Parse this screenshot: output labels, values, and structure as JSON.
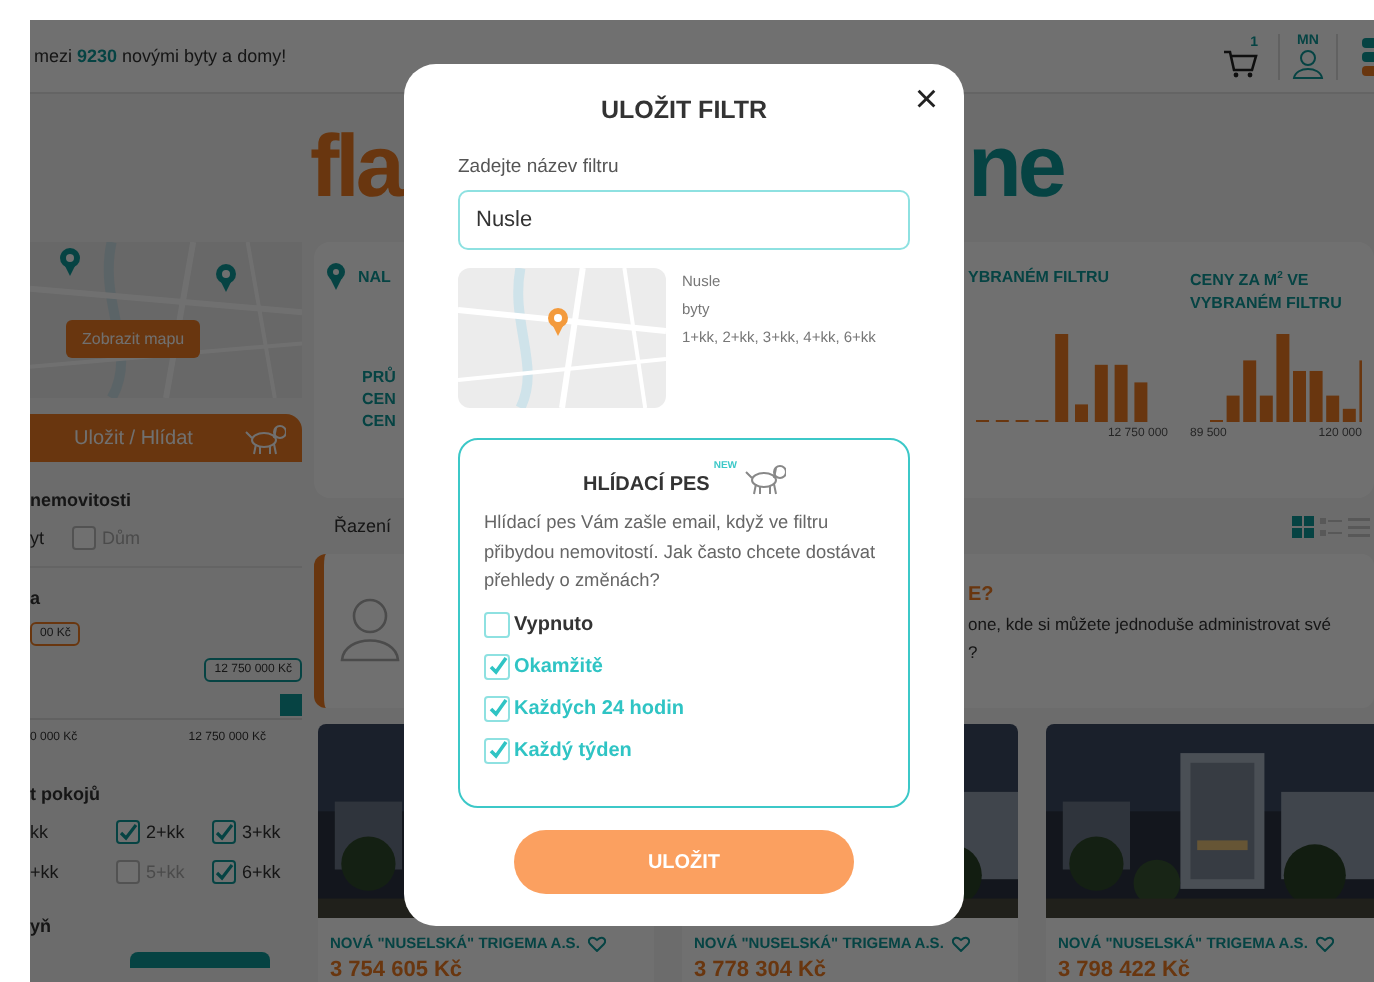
{
  "header": {
    "promo": "mezi **9230** novými byty a domy!",
    "cart_count": "1",
    "user_initials": "MN"
  },
  "logo": [
    "fla",
    "ne"
  ],
  "sidebar": {
    "map_button": "Zobrazit mapu",
    "save_bar": "Uložit / Hlídat",
    "property_heading": "nemovitosti",
    "property_options": [
      {
        "kind": "cut",
        "label": "yt"
      },
      {
        "kind": "checkbox",
        "label": "Dům",
        "checked": false,
        "disabled": true
      }
    ],
    "price": {
      "heading": "a",
      "min_field": "00 Kč",
      "max_tooltip": "12 750 000 Kč",
      "level": 1,
      "range_min": "0 000 Kč",
      "range_max": "12 750 000 Kč"
    },
    "rooms_heading": "t pokojů",
    "rooms": [
      {
        "kind": "cut",
        "label": "kk"
      },
      {
        "kind": "checkbox",
        "label": "2+kk",
        "checked": true,
        "disabled": false
      },
      {
        "kind": "checkbox",
        "label": "3+kk",
        "checked": true,
        "disabled": false
      },
      {
        "kind": "cut",
        "label": "+kk"
      },
      {
        "kind": "checkbox",
        "label": "5+kk",
        "checked": false,
        "disabled": true
      },
      {
        "kind": "checkbox",
        "label": "6+kk",
        "checked": true,
        "disabled": false
      }
    ],
    "next_heading": "yň"
  },
  "stats": {
    "found_label": "NAL",
    "average_lines": [
      "PRŮ",
      "CEN",
      "CEN"
    ],
    "charts": [
      {
        "title": "YBRANÉM FILTRU",
        "ticks": [
          "12 750 000"
        ]
      },
      {
        "title": "CENY ZA M$^{2}$ VE VYBRANÉM FILTRU",
        "ticks": [
          "89 500",
          "120 000"
        ]
      }
    ]
  },
  "sort_label": "Řazení",
  "views": [
    {
      "kind": "grid",
      "selected": true
    },
    {
      "kind": "list",
      "selected": false
    },
    {
      "kind": "rows",
      "selected": false
    }
  ],
  "promo_card": {
    "title": "E?",
    "lines": [
      "one, kde si můžete jednoduše administrovat své",
      "?"
    ]
  },
  "listings": [
    {
      "title": "NOVÁ \"NUSELSKÁ\" TRIGEMA A.S.",
      "price": "3 754 605 Kč"
    },
    {
      "title": "NOVÁ \"NUSELSKÁ\" TRIGEMA A.S.",
      "price": "3 778 304 Kč"
    },
    {
      "title": "NOVÁ \"NUSELSKÁ\" TRIGEMA A.S.",
      "price": "3 798 422 Kč"
    }
  ],
  "dialog": {
    "close_label": "×",
    "title": "ULOŽIT FILTR",
    "name_label": "Zadejte název filtru",
    "name_value": "Nusle",
    "summary": [
      "Nusle",
      "byty",
      "1+kk, 2+kk, 3+kk, 4+kk, 6+kk"
    ],
    "watchdog": {
      "title": "HLÍDACÍ PES",
      "badge": "NEW",
      "text": "Hlídací pes Vám zašle email, když ve filtru přibydou nemovitostí. Jak často chcete dostávat přehledy o změnách?",
      "options": [
        {
          "label": "Vypnuto",
          "checked": false
        },
        {
          "label": "Okamžitě",
          "checked": true
        },
        {
          "label": "Každých 24 hodin",
          "checked": true
        },
        {
          "label": "Každý týden",
          "checked": true
        }
      ]
    },
    "save_button": "ULOŽIT"
  }
}
